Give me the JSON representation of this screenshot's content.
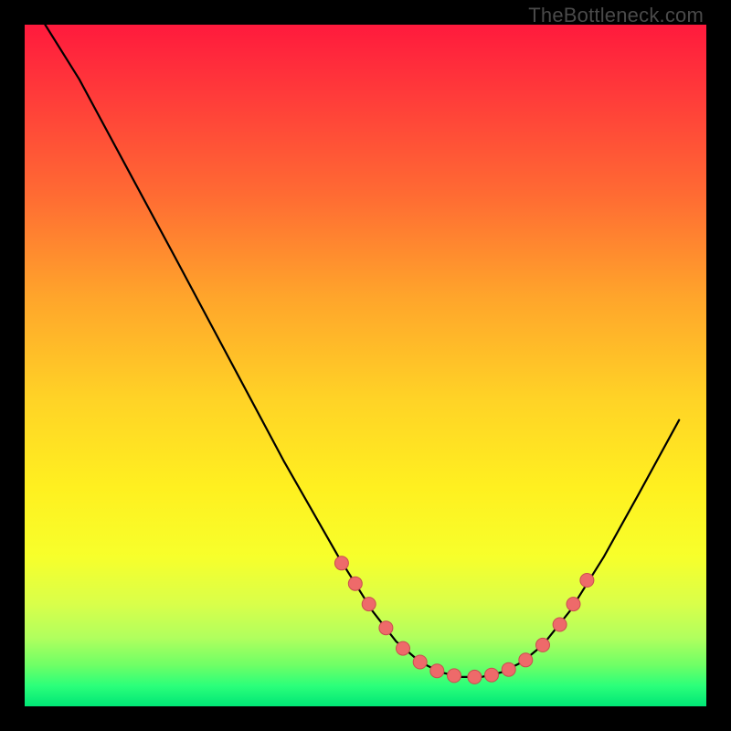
{
  "watermark": "TheBottleneck.com",
  "colors": {
    "background": "#000000",
    "curve": "#000000",
    "marker_fill": "#ee6a6a",
    "marker_stroke": "#c94f4f"
  },
  "chart_data": {
    "type": "line",
    "title": "",
    "xlabel": "",
    "ylabel": "",
    "xlim": [
      0,
      100
    ],
    "ylim": [
      0,
      100
    ],
    "series": [
      {
        "name": "curve",
        "x": [
          3,
          8,
          15,
          22,
          30,
          38,
          46,
          51,
          54.5,
          58,
          61,
          64,
          67,
          70,
          73,
          76,
          80,
          85,
          90,
          96
        ],
        "y": [
          100,
          92,
          79,
          66,
          51,
          36,
          22,
          14,
          9.5,
          6.5,
          5,
          4.3,
          4.3,
          5,
          6.5,
          9,
          14,
          22,
          31,
          42
        ]
      }
    ],
    "markers": {
      "name": "highlight-points",
      "x": [
        46.5,
        48.5,
        50.5,
        53,
        55.5,
        58,
        60.5,
        63,
        66,
        68.5,
        71,
        73.5,
        76,
        78.5,
        80.5,
        82.5
      ],
      "y": [
        21,
        18,
        15,
        11.5,
        8.5,
        6.5,
        5.2,
        4.5,
        4.3,
        4.6,
        5.4,
        6.8,
        9,
        12,
        15,
        18.5
      ]
    }
  }
}
